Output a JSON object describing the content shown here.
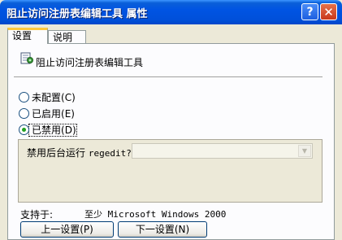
{
  "window": {
    "title": "阻止访问注册表编辑工具 属性"
  },
  "titlebar_buttons": {
    "help": "?",
    "close": "✕"
  },
  "tabs": [
    {
      "label": "设置",
      "active": true
    },
    {
      "label": "说明",
      "active": false
    }
  ],
  "policy": {
    "icon": "policy-setting-icon",
    "title": "阻止访问注册表编辑工具"
  },
  "radios": [
    {
      "label": "未配置",
      "mnemonic": "(C)",
      "checked": false
    },
    {
      "label": "已启用",
      "mnemonic": "(E)",
      "checked": false
    },
    {
      "label": "已禁用",
      "mnemonic": "(D)",
      "checked": true
    }
  ],
  "options": {
    "label": "禁用后台运行",
    "command": "regedit?",
    "value": ""
  },
  "supported": {
    "label": "支持于:",
    "value": "至少 Microsoft Windows 2000"
  },
  "buttons": {
    "prev": "上一设置(P)",
    "next": "下一设置(N)"
  },
  "colors": {
    "titlebar": "#0054e3",
    "window_bg": "#ece9d8",
    "tab_highlight": "#ffc83c",
    "radio_dot": "#21a121"
  }
}
